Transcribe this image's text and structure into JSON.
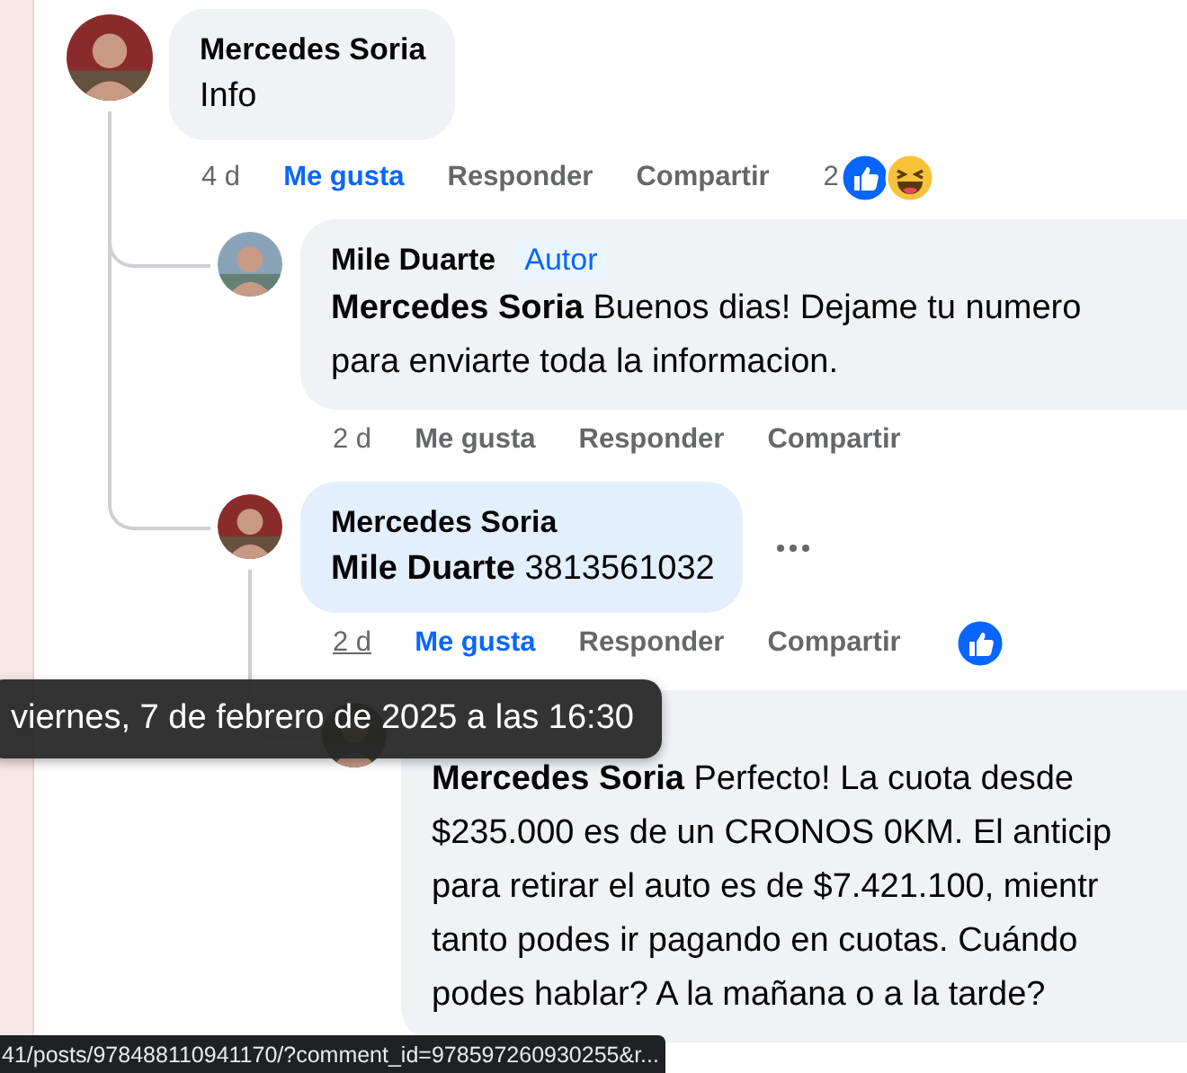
{
  "comments": [
    {
      "author": "Mercedes Soria",
      "color": "#8a2b2b",
      "lines": [
        "Info"
      ],
      "highlighted": false,
      "time": "4 d",
      "time_hovered": false,
      "like_label": "Me gusta",
      "liked": true,
      "reply_label": "Responder",
      "share_label": "Compartir",
      "reaction_count": "2",
      "reactions": [
        {
          "kind": "like"
        },
        {
          "kind": "haha"
        }
      ],
      "children": [
        {
          "author": "Mile Duarte",
          "badge": "Autor",
          "color": "#8aa3b8",
          "lines": [
            "**Mercedes Soria** Buenos dias! Dejame tu numero",
            "para enviarte toda la informacion."
          ],
          "highlighted": false,
          "time": "2 d",
          "time_hovered": false,
          "like_label": "Me gusta",
          "liked": false,
          "reply_label": "Responder",
          "share_label": "Compartir"
        },
        {
          "author": "Mercedes Soria",
          "color": "#8a2b2b",
          "lines": [
            "**Mile Duarte** 3813561032"
          ],
          "highlighted": true,
          "time": "2 d",
          "time_hovered": true,
          "like_label": "Me gusta",
          "liked": true,
          "reply_label": "Responder",
          "share_label": "Compartir",
          "reactions": [
            {
              "kind": "like"
            }
          ],
          "more_menu": true,
          "children": [
            {
              "lines": [
                "**Mercedes Soria** Perfecto! La cuota desde",
                "$235.000 es de un CRONOS 0KM. El anticip",
                "para retirar el auto es de $7.421.100, mientr",
                "tanto podes ir pagando en cuotas. Cuándo",
                "podes hablar? A la mañana o a la tarde?"
              ],
              "highlighted": false
            }
          ]
        }
      ]
    }
  ],
  "tooltip": "viernes, 7 de febrero de 2025 a las 16:30",
  "status_bar": "41/posts/978488110941170/?comment_id=978597260930255&r..."
}
